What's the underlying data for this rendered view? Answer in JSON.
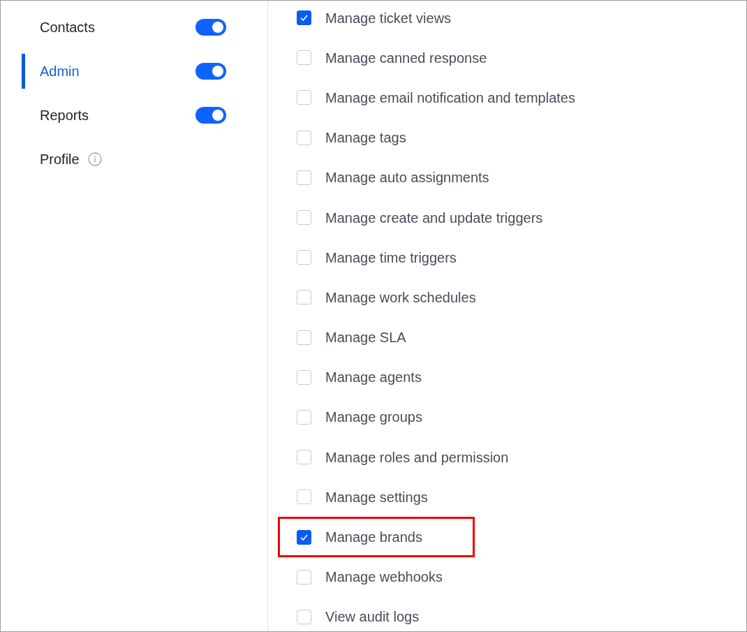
{
  "sidebar": {
    "items": [
      {
        "label": "Contacts",
        "selected": false,
        "kind": "toggle",
        "on": true
      },
      {
        "label": "Admin",
        "selected": true,
        "kind": "toggle",
        "on": true
      },
      {
        "label": "Reports",
        "selected": false,
        "kind": "toggle",
        "on": true
      },
      {
        "label": "Profile",
        "selected": false,
        "kind": "info"
      }
    ]
  },
  "permissions": [
    {
      "label": "Manage ticket views",
      "checked": true,
      "highlighted": false
    },
    {
      "label": "Manage canned response",
      "checked": false,
      "highlighted": false
    },
    {
      "label": "Manage email notification and templates",
      "checked": false,
      "highlighted": false
    },
    {
      "label": "Manage tags",
      "checked": false,
      "highlighted": false
    },
    {
      "label": "Manage auto assignments",
      "checked": false,
      "highlighted": false
    },
    {
      "label": "Manage create and update triggers",
      "checked": false,
      "highlighted": false
    },
    {
      "label": "Manage time triggers",
      "checked": false,
      "highlighted": false
    },
    {
      "label": "Manage work schedules",
      "checked": false,
      "highlighted": false
    },
    {
      "label": "Manage SLA",
      "checked": false,
      "highlighted": false
    },
    {
      "label": "Manage agents",
      "checked": false,
      "highlighted": false
    },
    {
      "label": "Manage groups",
      "checked": false,
      "highlighted": false
    },
    {
      "label": "Manage roles and permission",
      "checked": false,
      "highlighted": false
    },
    {
      "label": "Manage settings",
      "checked": false,
      "highlighted": false
    },
    {
      "label": "Manage brands",
      "checked": true,
      "highlighted": true
    },
    {
      "label": "Manage webhooks",
      "checked": false,
      "highlighted": false
    },
    {
      "label": "View audit logs",
      "checked": false,
      "highlighted": false
    }
  ]
}
